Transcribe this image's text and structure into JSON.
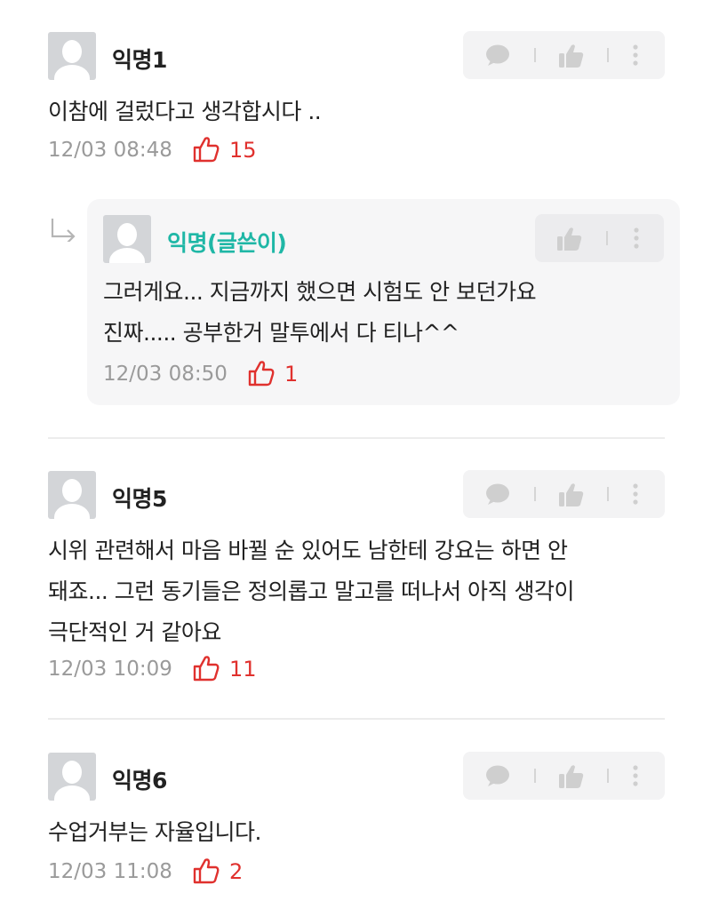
{
  "comments": [
    {
      "name": "익명1",
      "lines": [
        "이참에 걸렀다고 생각합시다 .."
      ],
      "time": "12/03 08:48",
      "likes": "15"
    },
    {
      "name": "익명5",
      "lines": [
        "시위 관련해서 마음 바뀔 순 있어도 남한테 강요는 하면 안",
        "돼죠... 그런 동기들은 정의롭고 말고를 떠나서 아직 생각이",
        "극단적인 거 같아요"
      ],
      "time": "12/03 10:09",
      "likes": "11"
    },
    {
      "name": "익명6",
      "lines": [
        "수업거부는 자율입니다."
      ],
      "time": "12/03 11:08",
      "likes": "2"
    }
  ],
  "reply": {
    "name": "익명(글쓴이)",
    "lines": [
      "그러게요... 지금까지 했으면 시험도 안 보던가요",
      "진짜..... 공부한거 말투에서 다 티나^^"
    ],
    "time": "12/03 08:50",
    "likes": "1"
  },
  "colors": {
    "author_name": "#1fb7a6",
    "like_red": "#e0312e",
    "meta_gray": "#9a9a9a",
    "icon_gray": "#cfcfcf"
  },
  "icons": {
    "comment": "speech-bubble-icon",
    "vote": "thumbs-up-icon",
    "more": "vertical-ellipsis-icon",
    "like": "thumbs-up-outline-icon",
    "reply_arrow": "reply-arrow-icon"
  }
}
